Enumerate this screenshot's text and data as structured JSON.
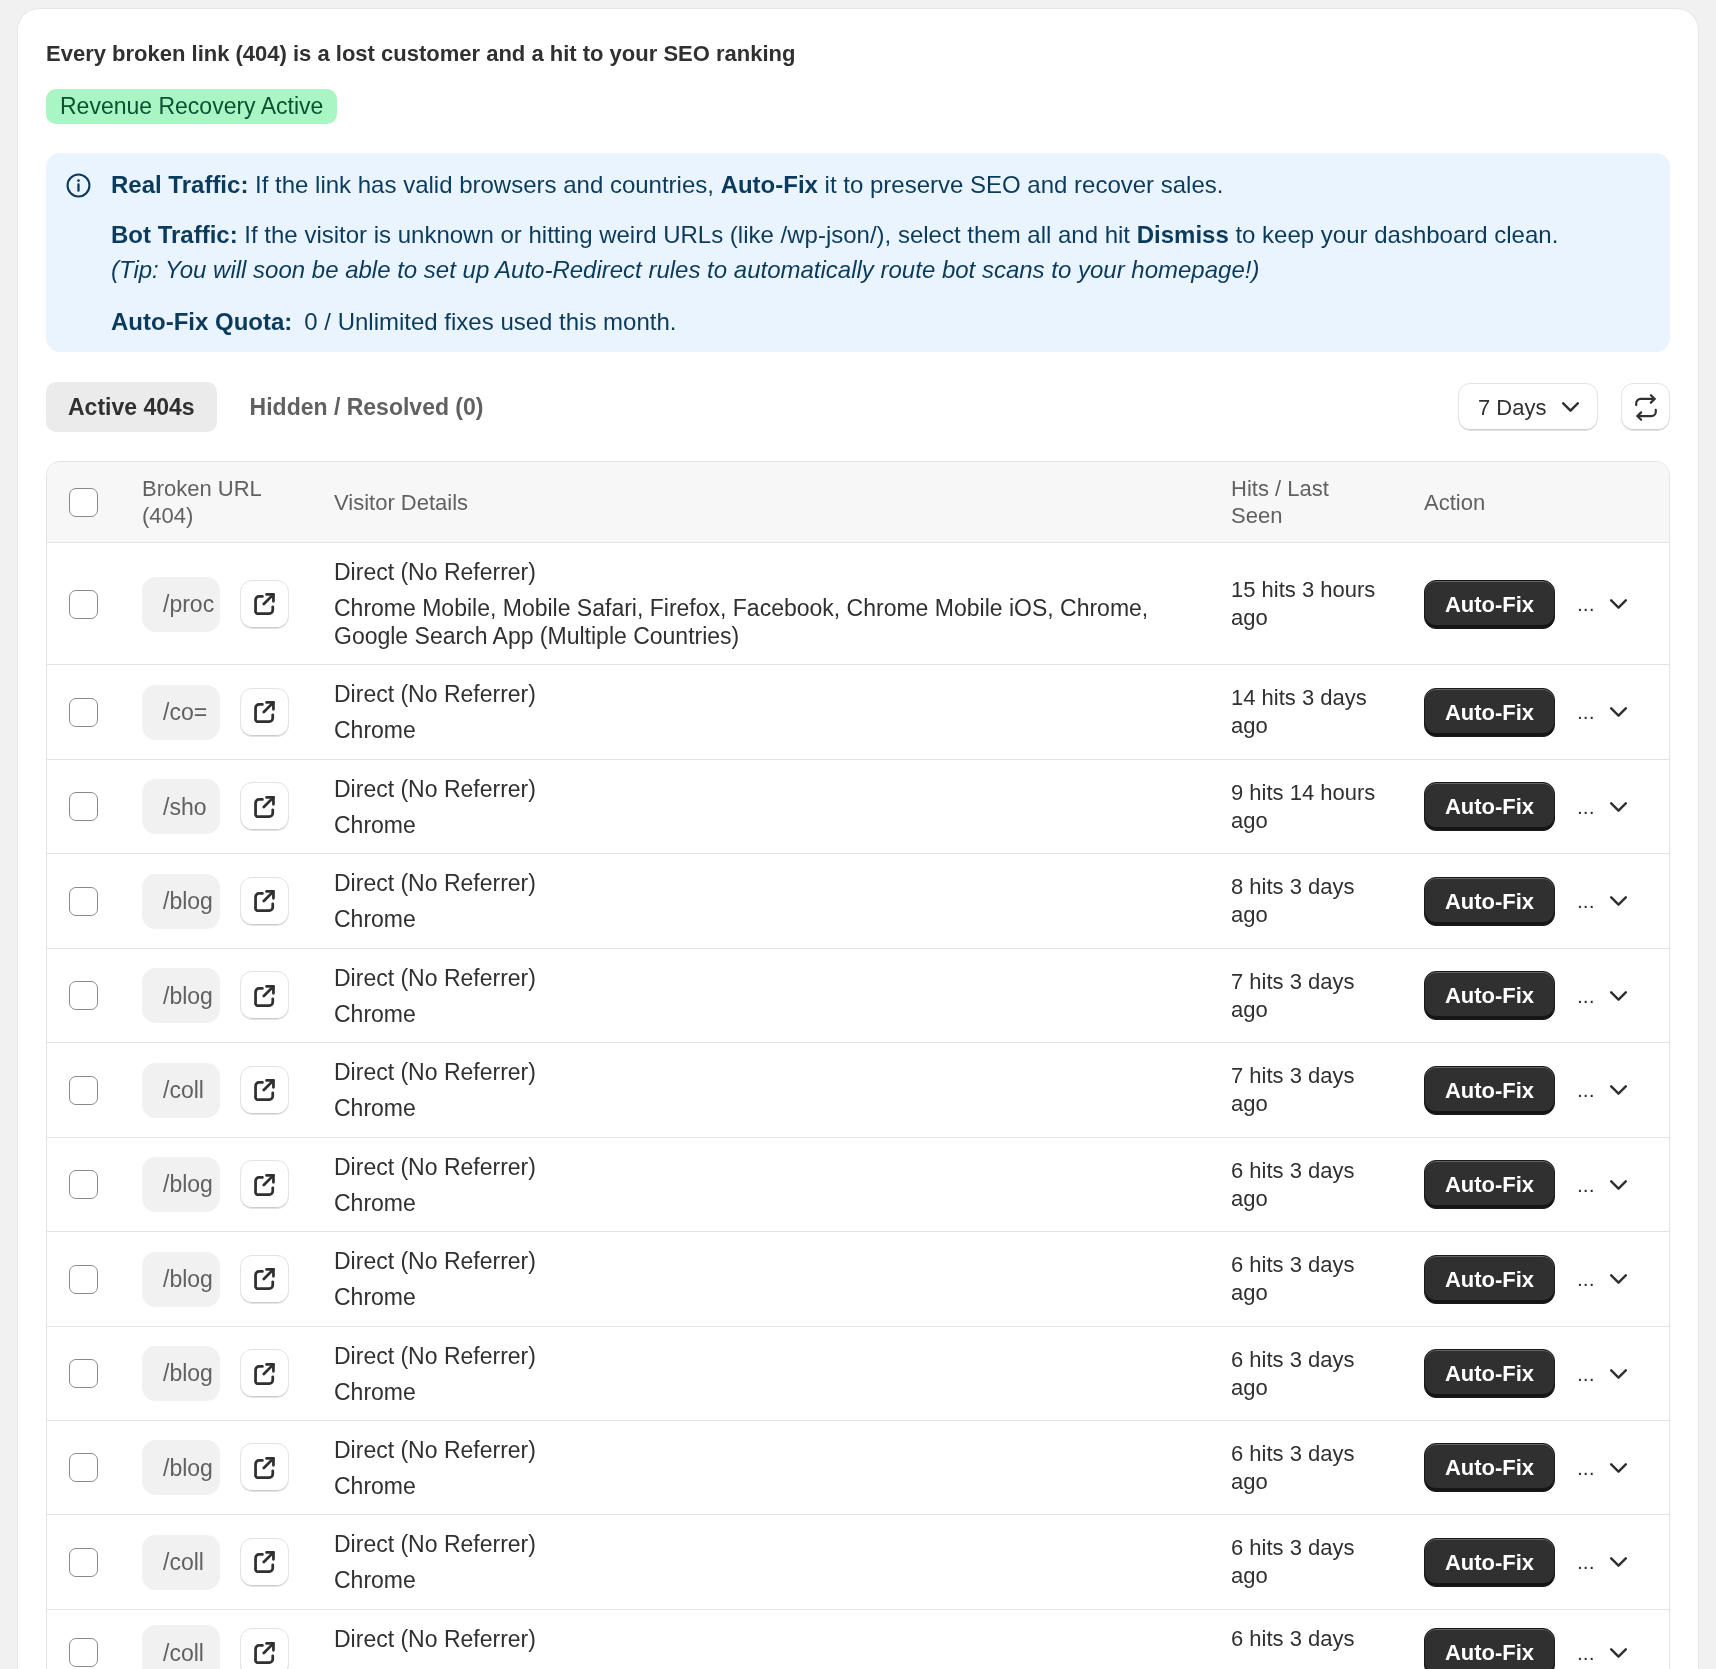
{
  "header": {
    "title": "Every broken link (404) is a lost customer and a hit to your SEO ranking",
    "badge": "Revenue Recovery Active"
  },
  "info": {
    "real_traffic": "**Real Traffic:** If the link has valid browsers and countries, **Auto-Fix** it to preserve SEO and recover sales.",
    "bot_traffic": "**Bot Traffic:** If the visitor is unknown or hitting weird URLs (like /wp-json/), select them all and hit **Dismiss** to keep your dashboard clean.",
    "tip": "(Tip: You will soon be able to set up Auto-Redirect rules to automatically route bot scans to your homepage!)",
    "quota_label": "Auto-Fix Quota:",
    "quota_value": "0 / Unlimited fixes used this month."
  },
  "tabs": [
    {
      "label": "Active 404s",
      "selected": true
    },
    {
      "label": "Hidden / Resolved (0)",
      "selected": false
    }
  ],
  "range_select": {
    "value": "7 Days"
  },
  "table": {
    "select_all": {
      "checked": false
    },
    "columns": [
      "Broken URL (404)",
      "Visitor Details",
      "Hits / Last Seen",
      "Action"
    ],
    "rows": [
      {
        "checked": false,
        "url": "/proc",
        "referrer": "Direct (No Referrer)",
        "browsers": "Chrome Mobile, Mobile Safari, Firefox, Facebook, Chrome Mobile iOS, Chrome, Google Search App (Multiple Countries)",
        "hits": "15 hits 3 hours ago",
        "action": "Auto-Fix",
        "more": "...",
        "expanded": false
      },
      {
        "checked": false,
        "url": "/co=",
        "referrer": "Direct (No Referrer)",
        "browsers": "Chrome",
        "hits": "14 hits 3 days ago",
        "action": "Auto-Fix",
        "more": "...",
        "expanded": false
      },
      {
        "checked": false,
        "url": "/sho",
        "referrer": "Direct (No Referrer)",
        "browsers": "Chrome",
        "hits": "9 hits 14 hours ago",
        "action": "Auto-Fix",
        "more": "...",
        "expanded": false
      },
      {
        "checked": false,
        "url": "/blog",
        "referrer": "Direct (No Referrer)",
        "browsers": "Chrome",
        "hits": "8 hits 3 days ago",
        "action": "Auto-Fix",
        "more": "...",
        "expanded": false
      },
      {
        "checked": false,
        "url": "/blog",
        "referrer": "Direct (No Referrer)",
        "browsers": "Chrome",
        "hits": "7 hits 3 days ago",
        "action": "Auto-Fix",
        "more": "...",
        "expanded": false
      },
      {
        "checked": false,
        "url": "/coll",
        "referrer": "Direct (No Referrer)",
        "browsers": "Chrome",
        "hits": "7 hits 3 days ago",
        "action": "Auto-Fix",
        "more": "...",
        "expanded": false
      },
      {
        "checked": false,
        "url": "/blog",
        "referrer": "Direct (No Referrer)",
        "browsers": "Chrome",
        "hits": "6 hits 3 days ago",
        "action": "Auto-Fix",
        "more": "...",
        "expanded": false
      },
      {
        "checked": false,
        "url": "/blog",
        "referrer": "Direct (No Referrer)",
        "browsers": "Chrome",
        "hits": "6 hits 3 days ago",
        "action": "Auto-Fix",
        "more": "...",
        "expanded": false
      },
      {
        "checked": false,
        "url": "/blog",
        "referrer": "Direct (No Referrer)",
        "browsers": "Chrome",
        "hits": "6 hits 3 days ago",
        "action": "Auto-Fix",
        "more": "...",
        "expanded": false
      },
      {
        "checked": false,
        "url": "/blog",
        "referrer": "Direct (No Referrer)",
        "browsers": "Chrome",
        "hits": "6 hits 3 days ago",
        "action": "Auto-Fix",
        "more": "...",
        "expanded": false
      },
      {
        "checked": false,
        "url": "/coll",
        "referrer": "Direct (No Referrer)",
        "browsers": "Chrome",
        "hits": "6 hits 3 days ago",
        "action": "Auto-Fix",
        "more": "...",
        "expanded": false
      },
      {
        "checked": false,
        "url": "/coll",
        "referrer": "Direct (No Referrer)",
        "hits": "6 hits 3 days",
        "action": "Auto-Fix",
        "more": "...",
        "expanded": false
      }
    ]
  }
}
